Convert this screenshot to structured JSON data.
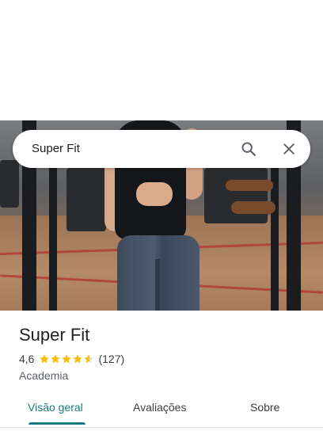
{
  "search": {
    "query": "Super Fit"
  },
  "place": {
    "name": "Super Fit",
    "rating": "4,6",
    "rating_value": 4.6,
    "review_count": "(127)",
    "category": "Academia"
  },
  "tabs": [
    {
      "label": "Visão geral",
      "active": true
    },
    {
      "label": "Avaliações",
      "active": false
    },
    {
      "label": "Sobre",
      "active": false
    }
  ],
  "colors": {
    "accent": "#1a7b7d",
    "star": "#fbbc04",
    "star_empty": "#dadce0"
  },
  "icons": [
    "search-icon",
    "close-icon",
    "star-icon"
  ]
}
